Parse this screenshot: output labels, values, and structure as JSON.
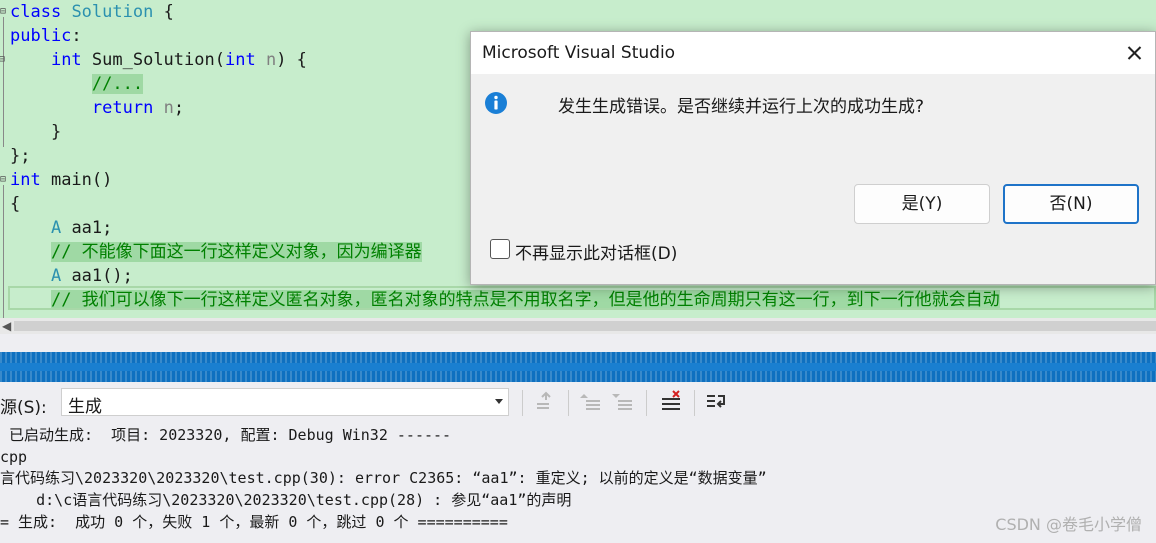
{
  "editor": {
    "lines": [
      {
        "parts": [
          {
            "t": "class",
            "c": "kw"
          },
          {
            "t": " ",
            "c": ""
          },
          {
            "t": "Solution",
            "c": "cls"
          },
          {
            "t": " {",
            "c": ""
          }
        ]
      },
      {
        "parts": [
          {
            "t": "public",
            "c": "kw"
          },
          {
            "t": ":",
            "c": ""
          }
        ]
      },
      {
        "parts": [
          {
            "t": "    ",
            "c": ""
          },
          {
            "t": "int",
            "c": "kw"
          },
          {
            "t": " Sum_Solution(",
            "c": ""
          },
          {
            "t": "int",
            "c": "kw"
          },
          {
            "t": " ",
            "c": ""
          },
          {
            "t": "n",
            "c": "prm"
          },
          {
            "t": ") {",
            "c": ""
          }
        ]
      },
      {
        "parts": [
          {
            "t": "        ",
            "c": ""
          },
          {
            "t": "//...",
            "c": "cmt cmt-hl"
          }
        ]
      },
      {
        "parts": [
          {
            "t": "        ",
            "c": ""
          },
          {
            "t": "return",
            "c": "kw"
          },
          {
            "t": " ",
            "c": ""
          },
          {
            "t": "n",
            "c": "prm"
          },
          {
            "t": ";",
            "c": ""
          }
        ]
      },
      {
        "parts": [
          {
            "t": "    }",
            "c": ""
          }
        ]
      },
      {
        "parts": [
          {
            "t": "};",
            "c": ""
          }
        ]
      },
      {
        "parts": [
          {
            "t": "int",
            "c": "kw"
          },
          {
            "t": " main()",
            "c": ""
          }
        ]
      },
      {
        "parts": [
          {
            "t": "{",
            "c": ""
          }
        ]
      },
      {
        "parts": [
          {
            "t": "    ",
            "c": ""
          },
          {
            "t": "A",
            "c": "cls"
          },
          {
            "t": " aa1;",
            "c": ""
          }
        ]
      },
      {
        "parts": [
          {
            "t": "    ",
            "c": ""
          },
          {
            "t": "// 不能像下面这一行这样定义对象，因为编译器",
            "c": "cmt cmt-hl"
          }
        ]
      },
      {
        "parts": [
          {
            "t": "    ",
            "c": ""
          },
          {
            "t": "A",
            "c": "cls"
          },
          {
            "t": " aa1();",
            "c": ""
          }
        ]
      },
      {
        "parts": [
          {
            "t": "    ",
            "c": ""
          },
          {
            "t": "// 我们可以像下一行这样定义匿名对象，匿名对象的特点是不用取名字，但是他的生命周期只有这一行，到下一行他就会自动",
            "c": "cmt cmt-hl"
          }
        ]
      }
    ]
  },
  "dialog": {
    "title": "Microsoft Visual Studio",
    "message": "发生生成错误。是否继续并运行上次的成功生成?",
    "yes_label": "是(Y)",
    "no_label": "否(N)",
    "checkbox_label": "不再显示此对话框(D)",
    "icon": "info-icon"
  },
  "output": {
    "source_label": "源(S):",
    "source_value": "生成",
    "lines": [
      " 已启动生成:  项目: 2023320, 配置: Debug Win32 ------",
      "cpp",
      "言代码练习\\2023320\\2023320\\test.cpp(30): error C2365: “aa1”: 重定义; 以前的定义是“数据变量”",
      "    d:\\c语言代码练习\\2023320\\2023320\\test.cpp(28) : 参见“aa1”的声明",
      "= 生成:  成功 0 个，失败 1 个，最新 0 个，跳过 0 个 =========="
    ]
  },
  "watermark": "CSDN @卷毛小学僧",
  "colors": {
    "editor_bg": "#c7edcc",
    "keyword": "#0000ff",
    "class_name": "#2b91af",
    "comment": "#008000",
    "accent_blue": "#1e73c8"
  }
}
